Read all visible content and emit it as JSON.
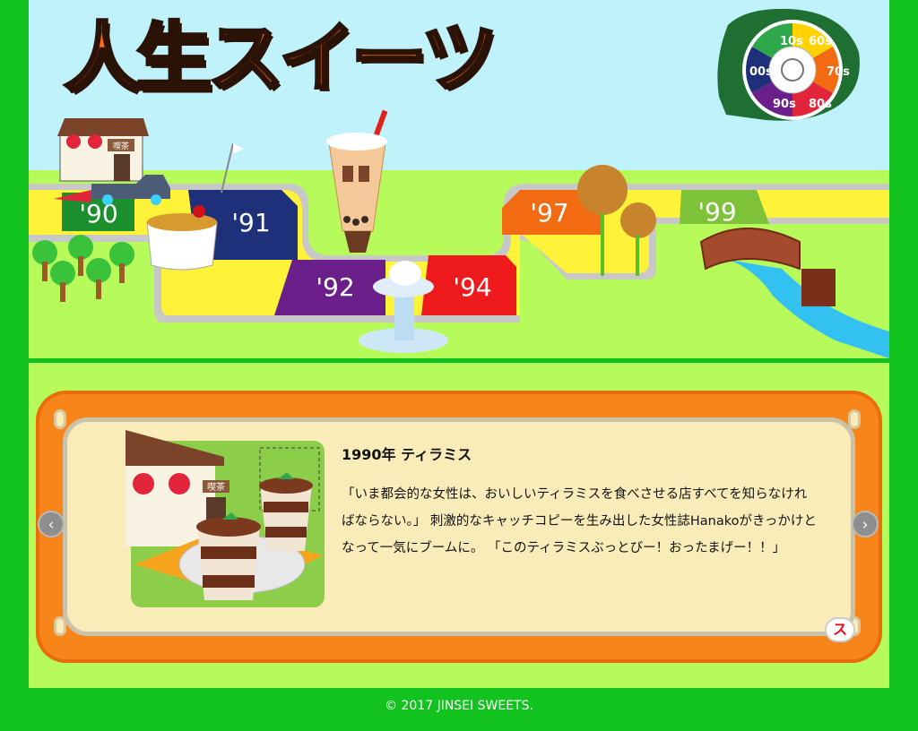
{
  "game": {
    "logo_title": "人生スイーツ",
    "spinner_labels": [
      "10s",
      "60s",
      "70s",
      "80s",
      "90s",
      "00s"
    ],
    "board_years": [
      "'90",
      "'91",
      "'92",
      "'94",
      "'97",
      "'99"
    ],
    "shop_sign": "喫茶"
  },
  "card": {
    "title": "1990年 ティラミス",
    "description": "「いま都会的な女性は、おいしいティラミスを食べさせる店すべてを知らなければならない。」 刺激的なキャッチコピーを生み出した女性誌Hanakoがきっかけとなって一気にブームに。 「このティラミスぶっとびー！おったまげー！！」",
    "image_sign": "喫茶",
    "badge": "ス"
  },
  "nav": {
    "prev_glyph": "‹",
    "next_glyph": "›"
  },
  "footer": {
    "copyright": "© 2017 JINSEI SWEETS."
  },
  "colors": {
    "frame_green": "#12c21f",
    "sky": "#bff2fb",
    "grass": "#b6fb5a",
    "card_frame": "#f7851a",
    "card_bg": "#faecb9"
  }
}
